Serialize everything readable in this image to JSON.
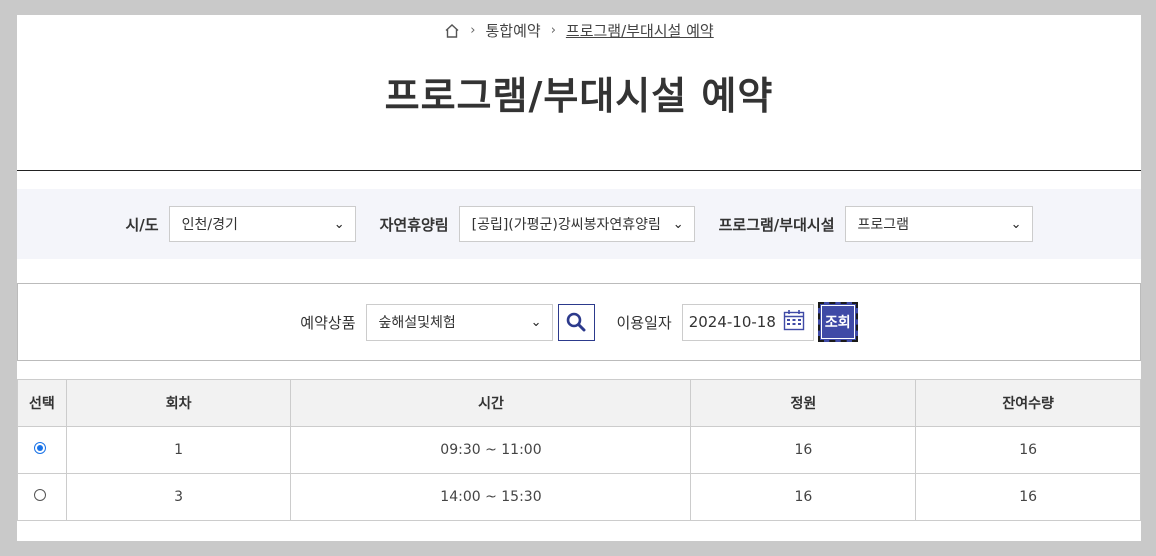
{
  "breadcrumb": {
    "items": [
      "통합예약",
      "프로그램/부대시설 예약"
    ]
  },
  "page_title": "프로그램/부대시설 예약",
  "filters": {
    "region_label": "시/도",
    "region_value": "인천/경기",
    "forest_label": "자연휴양림",
    "forest_value": "[공립](가평군)강씨봉자연휴양림",
    "type_label": "프로그램/부대시설",
    "type_value": "프로그램"
  },
  "search": {
    "product_label": "예약상품",
    "product_value": "숲해설및체험",
    "date_label": "이용일자",
    "date_value": "2024-10-18",
    "query_label": "조회"
  },
  "table": {
    "headers": [
      "선택",
      "회차",
      "시간",
      "정원",
      "잔여수량"
    ],
    "rows": [
      {
        "selected": true,
        "round": "1",
        "time": "09:30 ~ 11:00",
        "capacity": "16",
        "remaining": "16"
      },
      {
        "selected": false,
        "round": "3",
        "time": "14:00 ~ 15:30",
        "capacity": "16",
        "remaining": "16"
      }
    ]
  },
  "colors": {
    "accent": "#3f4aa6",
    "filter_bg": "#f4f5fa"
  }
}
